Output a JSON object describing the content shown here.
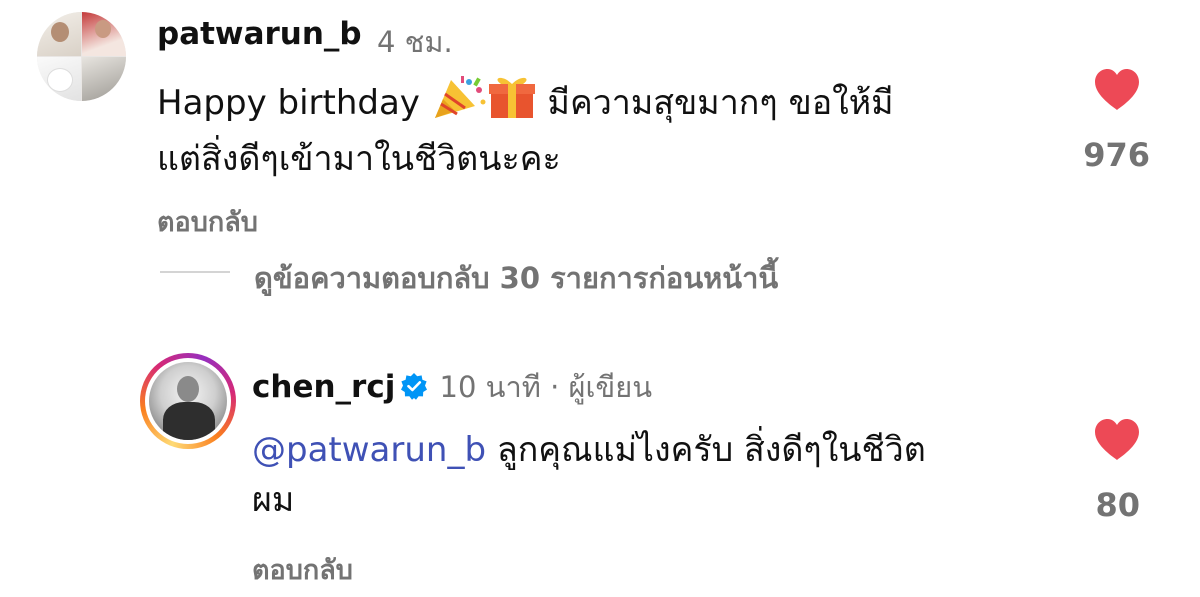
{
  "comments": [
    {
      "username": "patwarun_b",
      "meta": "4 ชม.",
      "text_part1": "Happy birthday ",
      "emoji_names": [
        "party-popper-icon",
        "gift-icon"
      ],
      "text_part2": " มีความสุขมากๆ ขอให้มี",
      "text_line2": "แต่สิ่งดีๆเข้ามาในชีวิตนะคะ",
      "likes": "976",
      "reply_label": "ตอบกลับ",
      "view_replies": "ดูข้อความตอบกลับ 30 รายการก่อนหน้านี้"
    },
    {
      "username": "chen_rcj",
      "verified": true,
      "meta": "10 นาที · ผู้เขียน",
      "mention": "@patwarun_b",
      "text_part1": " ลูกคุณแม่ไงครับ สิ่งดีๆในชีวิต",
      "text_line2": "ผม",
      "likes": "80",
      "reply_label": "ตอบกลับ"
    }
  ],
  "colors": {
    "heart": "#ed4956",
    "mention": "#3f51b5",
    "verified": "#0095f6",
    "secondary_text": "#737373"
  }
}
